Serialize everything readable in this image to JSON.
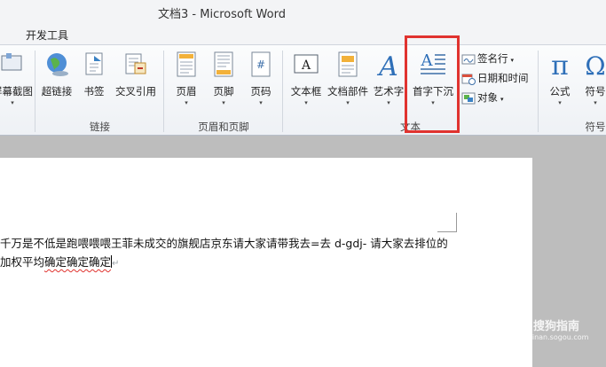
{
  "window": {
    "title": "文档3 - Microsoft Word"
  },
  "tabs": {
    "developer": "开发工具"
  },
  "ribbon": {
    "screenshot_label": "屏幕截图",
    "hyperlink_label": "超链接",
    "bookmark_label": "书签",
    "crossref_label": "交叉引用",
    "links_group": "链接",
    "header_label": "页眉",
    "footer_label": "页脚",
    "pagenum_label": "页码",
    "headerfooter_group": "页眉和页脚",
    "textbox_label": "文本框",
    "quickparts_label": "文档部件",
    "wordart_label": "艺术字",
    "dropcap_label": "首字下沉",
    "signature_label": "签名行",
    "datetime_label": "日期和时间",
    "object_label": "对象",
    "text_group": "文本",
    "equation_label": "公式",
    "symbol_label": "符号",
    "symbols_group": "符号",
    "dropdown_glyph": "▾"
  },
  "document": {
    "line1": "千万是不低是跑喂喂喂王菲未成交的旗舰店京东请大家请带我去=去 d-gdj- 请大家去排位的",
    "line2_plain": "加权平均",
    "line2_underlined": "确定确定确定",
    "paragraph_mark": "↵"
  },
  "watermark": {
    "text": "搜狗指南",
    "url": "zhinan.sogou.com"
  },
  "colors": {
    "highlight": "#e0332f"
  }
}
